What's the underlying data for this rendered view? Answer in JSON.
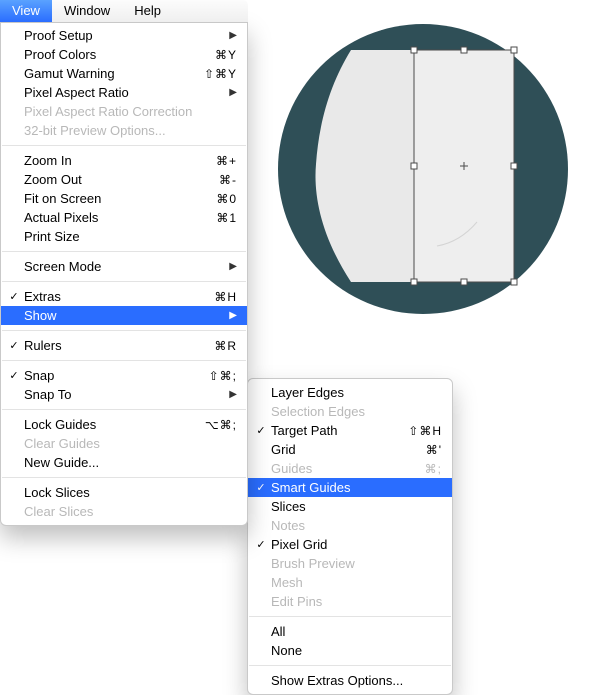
{
  "menubar": {
    "items": [
      {
        "label": "View",
        "selected": true
      },
      {
        "label": "Window",
        "selected": false
      },
      {
        "label": "Help",
        "selected": false
      }
    ]
  },
  "view_menu": [
    {
      "type": "item",
      "check": "",
      "label": "Proof Setup",
      "shortcut": "",
      "submenu": true,
      "disabled": false
    },
    {
      "type": "item",
      "check": "",
      "label": "Proof Colors",
      "shortcut": "⌘Y",
      "submenu": false,
      "disabled": false
    },
    {
      "type": "item",
      "check": "",
      "label": "Gamut Warning",
      "shortcut": "⇧⌘Y",
      "submenu": false,
      "disabled": false
    },
    {
      "type": "item",
      "check": "",
      "label": "Pixel Aspect Ratio",
      "shortcut": "",
      "submenu": true,
      "disabled": false
    },
    {
      "type": "item",
      "check": "",
      "label": "Pixel Aspect Ratio Correction",
      "shortcut": "",
      "submenu": false,
      "disabled": true
    },
    {
      "type": "item",
      "check": "",
      "label": "32-bit Preview Options...",
      "shortcut": "",
      "submenu": false,
      "disabled": true
    },
    {
      "type": "sep"
    },
    {
      "type": "item",
      "check": "",
      "label": "Zoom In",
      "shortcut": "⌘+",
      "submenu": false,
      "disabled": false
    },
    {
      "type": "item",
      "check": "",
      "label": "Zoom Out",
      "shortcut": "⌘-",
      "submenu": false,
      "disabled": false
    },
    {
      "type": "item",
      "check": "",
      "label": "Fit on Screen",
      "shortcut": "⌘0",
      "submenu": false,
      "disabled": false
    },
    {
      "type": "item",
      "check": "",
      "label": "Actual Pixels",
      "shortcut": "⌘1",
      "submenu": false,
      "disabled": false
    },
    {
      "type": "item",
      "check": "",
      "label": "Print Size",
      "shortcut": "",
      "submenu": false,
      "disabled": false
    },
    {
      "type": "sep"
    },
    {
      "type": "item",
      "check": "",
      "label": "Screen Mode",
      "shortcut": "",
      "submenu": true,
      "disabled": false
    },
    {
      "type": "sep"
    },
    {
      "type": "item",
      "check": "✓",
      "label": "Extras",
      "shortcut": "⌘H",
      "submenu": false,
      "disabled": false
    },
    {
      "type": "item",
      "check": "",
      "label": "Show",
      "shortcut": "",
      "submenu": true,
      "disabled": false,
      "highlight": true
    },
    {
      "type": "sep"
    },
    {
      "type": "item",
      "check": "✓",
      "label": "Rulers",
      "shortcut": "⌘R",
      "submenu": false,
      "disabled": false
    },
    {
      "type": "sep"
    },
    {
      "type": "item",
      "check": "✓",
      "label": "Snap",
      "shortcut": "⇧⌘;",
      "submenu": false,
      "disabled": false
    },
    {
      "type": "item",
      "check": "",
      "label": "Snap To",
      "shortcut": "",
      "submenu": true,
      "disabled": false
    },
    {
      "type": "sep"
    },
    {
      "type": "item",
      "check": "",
      "label": "Lock Guides",
      "shortcut": "⌥⌘;",
      "submenu": false,
      "disabled": false
    },
    {
      "type": "item",
      "check": "",
      "label": "Clear Guides",
      "shortcut": "",
      "submenu": false,
      "disabled": true
    },
    {
      "type": "item",
      "check": "",
      "label": "New Guide...",
      "shortcut": "",
      "submenu": false,
      "disabled": false
    },
    {
      "type": "sep"
    },
    {
      "type": "item",
      "check": "",
      "label": "Lock Slices",
      "shortcut": "",
      "submenu": false,
      "disabled": false
    },
    {
      "type": "item",
      "check": "",
      "label": "Clear Slices",
      "shortcut": "",
      "submenu": false,
      "disabled": true
    }
  ],
  "show_menu": [
    {
      "type": "item",
      "check": "",
      "label": "Layer Edges",
      "shortcut": "",
      "disabled": false
    },
    {
      "type": "item",
      "check": "",
      "label": "Selection Edges",
      "shortcut": "",
      "disabled": true
    },
    {
      "type": "item",
      "check": "✓",
      "label": "Target Path",
      "shortcut": "⇧⌘H",
      "disabled": false
    },
    {
      "type": "item",
      "check": "",
      "label": "Grid",
      "shortcut": "⌘'",
      "disabled": false
    },
    {
      "type": "item",
      "check": "",
      "label": "Guides",
      "shortcut": "⌘;",
      "disabled": true
    },
    {
      "type": "item",
      "check": "✓",
      "label": "Smart Guides",
      "shortcut": "",
      "disabled": false,
      "highlight": true
    },
    {
      "type": "item",
      "check": "",
      "label": "Slices",
      "shortcut": "",
      "disabled": false
    },
    {
      "type": "item",
      "check": "",
      "label": "Notes",
      "shortcut": "",
      "disabled": true
    },
    {
      "type": "item",
      "check": "✓",
      "label": "Pixel Grid",
      "shortcut": "",
      "disabled": false
    },
    {
      "type": "item",
      "check": "",
      "label": "Brush Preview",
      "shortcut": "",
      "disabled": true
    },
    {
      "type": "item",
      "check": "",
      "label": "Mesh",
      "shortcut": "",
      "disabled": true
    },
    {
      "type": "item",
      "check": "",
      "label": "Edit Pins",
      "shortcut": "",
      "disabled": true
    },
    {
      "type": "sep"
    },
    {
      "type": "item",
      "check": "",
      "label": "All",
      "shortcut": "",
      "disabled": false
    },
    {
      "type": "item",
      "check": "",
      "label": "None",
      "shortcut": "",
      "disabled": false
    },
    {
      "type": "sep"
    },
    {
      "type": "item",
      "check": "",
      "label": "Show Extras Options...",
      "shortcut": "",
      "disabled": false
    }
  ],
  "artwork": {
    "circle_color": "#2f4f57",
    "shape_fill": "#e9e9e9",
    "bbox_stroke": "#4b4b4b"
  }
}
